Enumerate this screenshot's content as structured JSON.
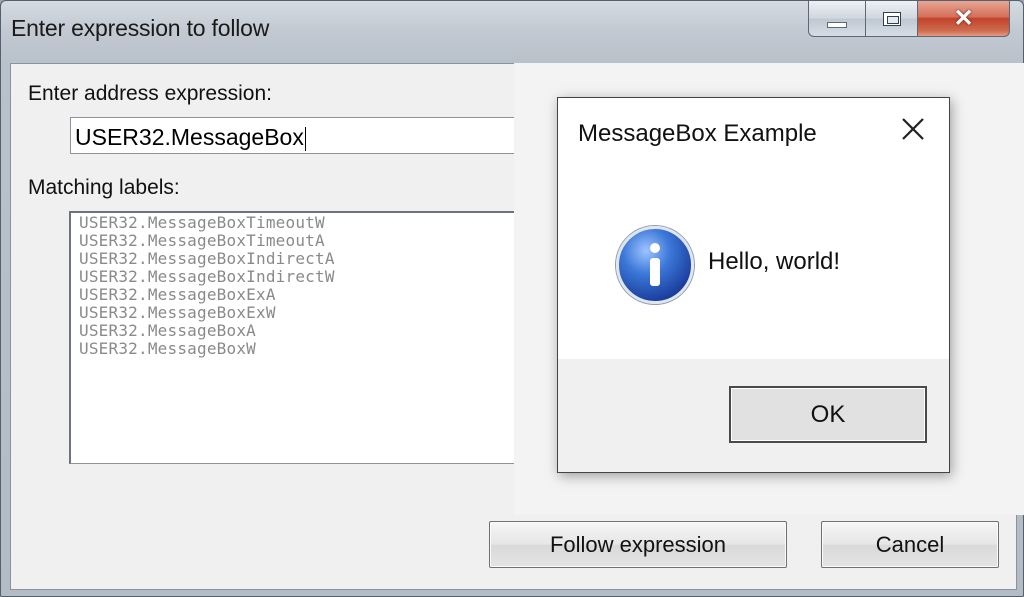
{
  "window": {
    "title": "Enter expression to follow"
  },
  "dialog": {
    "address_label": "Enter address expression:",
    "address_value": "USER32.MessageBox",
    "matching_label": "Matching labels:",
    "matches": [
      "USER32.MessageBoxTimeoutW",
      "USER32.MessageBoxTimeoutA",
      "USER32.MessageBoxIndirectA",
      "USER32.MessageBoxIndirectW",
      "USER32.MessageBoxExA",
      "USER32.MessageBoxExW",
      "USER32.MessageBoxA",
      "USER32.MessageBoxW"
    ],
    "follow_label": "Follow expression",
    "cancel_label": "Cancel"
  },
  "messagebox": {
    "title": "MessageBox Example",
    "text": "Hello, world!",
    "ok_label": "OK",
    "icon": "information-icon"
  },
  "colors": {
    "close_button": "#c2432a",
    "info_icon": "#3c78d8"
  }
}
